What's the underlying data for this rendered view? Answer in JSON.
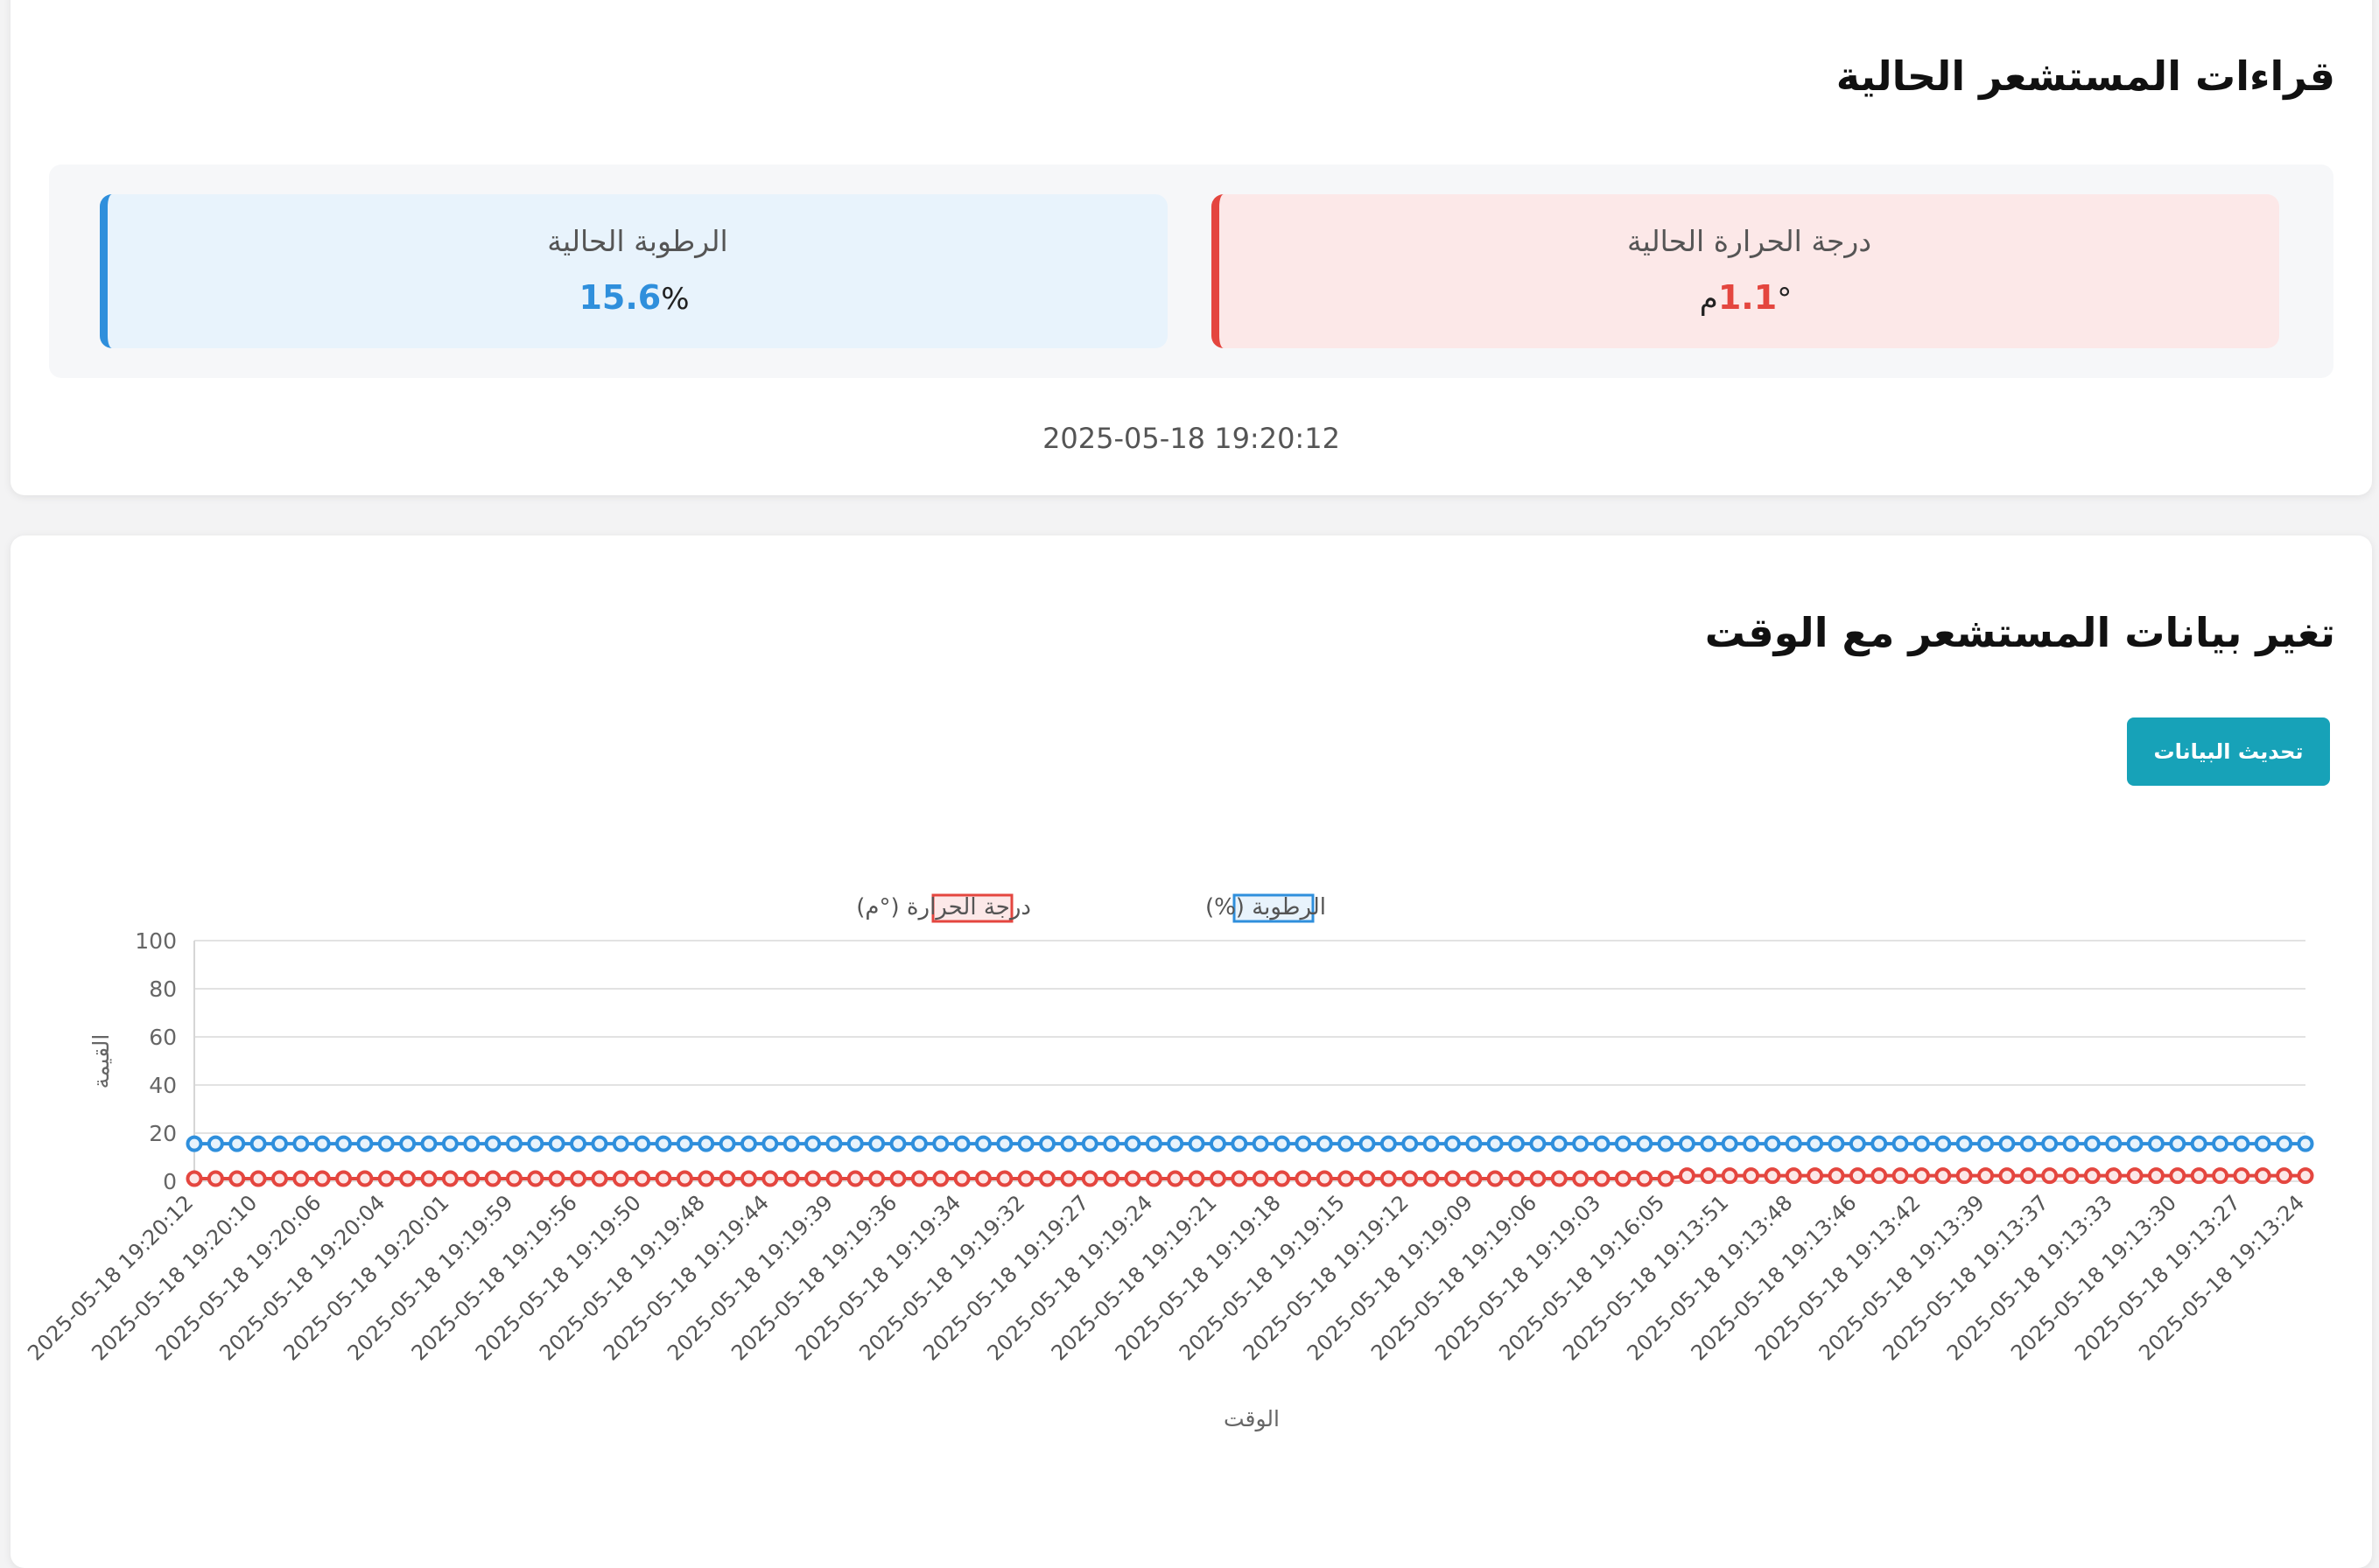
{
  "current": {
    "title": "قراءات المستشعر الحالية",
    "humidity": {
      "label": "الرطوبة الحالية",
      "value": "15.6",
      "unit": "%"
    },
    "temperature": {
      "label": "درجة الحرارة الحالية",
      "value": "1.1",
      "unit": "°م"
    },
    "timestamp": "2025-05-18 19:20:12",
    "colors": {
      "humidity": "#2f8fdc",
      "temperature": "#e4463f"
    }
  },
  "history": {
    "title": "تغير بيانات المستشعر مع الوقت",
    "refresh_label": "تحديث البيانات",
    "refresh_color": "#17a2b8"
  },
  "chart_data": {
    "type": "line",
    "xlabel": "الوقت",
    "ylabel": "القيمة",
    "ylim": [
      0,
      100
    ],
    "yticks": [
      0,
      20,
      40,
      60,
      80,
      100
    ],
    "grid": true,
    "legend_position": "top",
    "point_count": 100,
    "switch_index": 70,
    "tick_labels": [
      "2025-05-18 19:20:12",
      "2025-05-18 19:20:10",
      "2025-05-18 19:20:06",
      "2025-05-18 19:20:04",
      "2025-05-18 19:20:01",
      "2025-05-18 19:19:59",
      "2025-05-18 19:19:56",
      "2025-05-18 19:19:50",
      "2025-05-18 19:19:48",
      "2025-05-18 19:19:44",
      "2025-05-18 19:19:39",
      "2025-05-18 19:19:36",
      "2025-05-18 19:19:34",
      "2025-05-18 19:19:32",
      "2025-05-18 19:19:27",
      "2025-05-18 19:19:24",
      "2025-05-18 19:19:21",
      "2025-05-18 19:19:18",
      "2025-05-18 19:19:15",
      "2025-05-18 19:19:12",
      "2025-05-18 19:19:09",
      "2025-05-18 19:19:06",
      "2025-05-18 19:19:03",
      "2025-05-18 19:16:05",
      "2025-05-18 19:13:51",
      "2025-05-18 19:13:48",
      "2025-05-18 19:13:46",
      "2025-05-18 19:13:42",
      "2025-05-18 19:13:39",
      "2025-05-18 19:13:37",
      "2025-05-18 19:13:33",
      "2025-05-18 19:13:30",
      "2025-05-18 19:13:27",
      "2025-05-18 19:13:24"
    ],
    "series": [
      {
        "name": "الرطوبة (%)",
        "color": "#2f8fdc",
        "fill": "#e8f3fc",
        "value_before": 15.6,
        "value_after": 15.6
      },
      {
        "name": "درجة الحرارة (°م)",
        "color": "#e4463f",
        "fill": "#fce8e8",
        "value_before": 1.1,
        "value_after": 2.3
      }
    ]
  }
}
